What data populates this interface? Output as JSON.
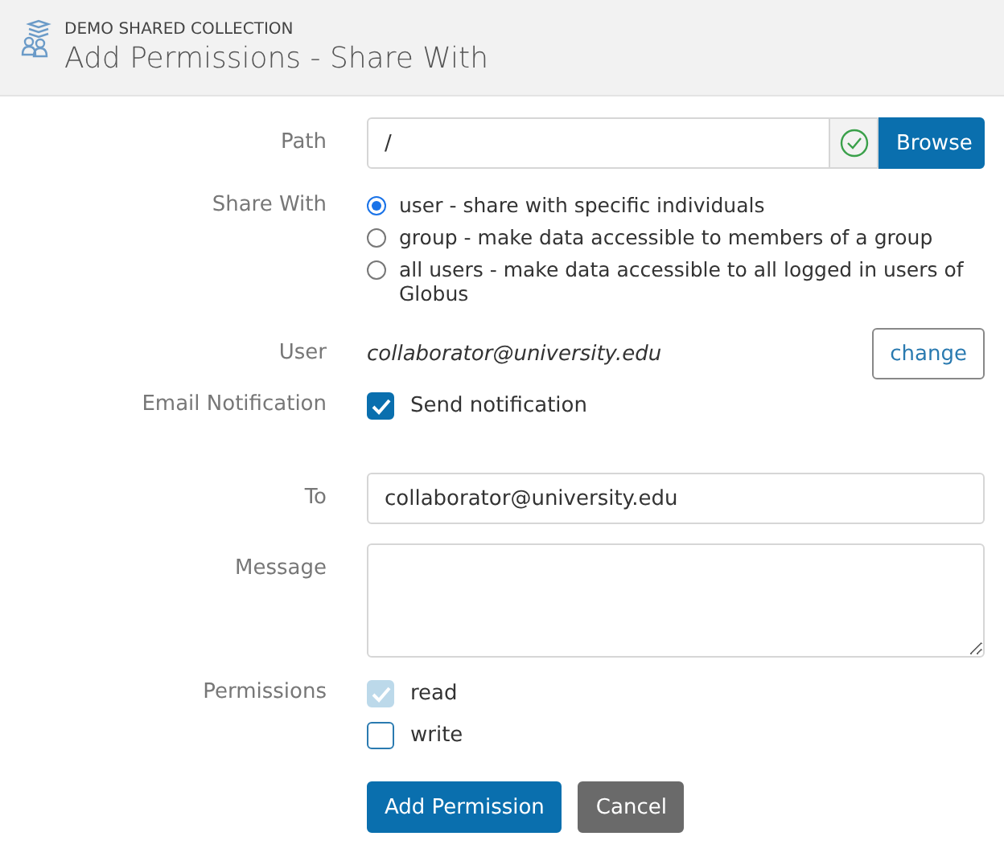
{
  "header": {
    "subtitle": "DEMO SHARED COLLECTION",
    "title": "Add Permissions - Share With"
  },
  "path": {
    "label": "Path",
    "value": "/",
    "valid": true,
    "button": "Browse"
  },
  "share_with": {
    "label": "Share With",
    "options": [
      {
        "label": "user - share with specific individuals",
        "selected": true
      },
      {
        "label": "group - make data accessible to members of a group",
        "selected": false
      },
      {
        "label": "all users - make data accessible to all logged in users of Globus",
        "selected": false
      }
    ]
  },
  "user": {
    "label": "User",
    "value": "collaborator@university.edu",
    "button": "change"
  },
  "email_notification": {
    "label": "Email Notification",
    "checkbox": {
      "label": "Send notification",
      "checked": true,
      "disabled": false
    }
  },
  "to": {
    "label": "To",
    "value": "collaborator@university.edu"
  },
  "message": {
    "label": "Message"
  },
  "permissions": {
    "label": "Permissions",
    "items": [
      {
        "label": "read",
        "checked": true,
        "disabled": true
      },
      {
        "label": "write",
        "checked": false,
        "disabled": false
      }
    ]
  },
  "buttons": {
    "primary": "Add Permission",
    "secondary": "Cancel"
  }
}
